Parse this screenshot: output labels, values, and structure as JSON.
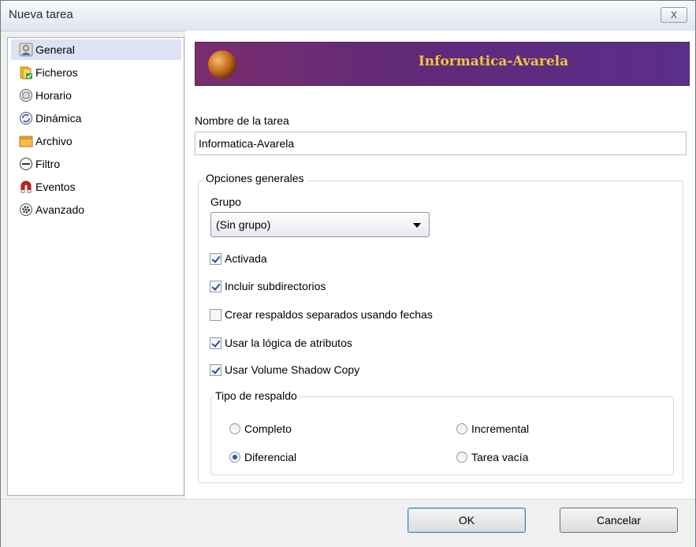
{
  "window": {
    "title": "Nueva tarea",
    "close_label": "X"
  },
  "sidebar": {
    "items": [
      {
        "label": "General",
        "icon": "user-icon",
        "selected": true
      },
      {
        "label": "Ficheros",
        "icon": "files-icon"
      },
      {
        "label": "Horario",
        "icon": "clock-icon"
      },
      {
        "label": "Dinámica",
        "icon": "dynamic-icon"
      },
      {
        "label": "Archivo",
        "icon": "folder-icon"
      },
      {
        "label": "Filtro",
        "icon": "filter-icon"
      },
      {
        "label": "Eventos",
        "icon": "magnet-icon"
      },
      {
        "label": "Avanzado",
        "icon": "gear-icon"
      }
    ]
  },
  "banner": {
    "title": "Informatica-Avarela"
  },
  "task_name": {
    "label": "Nombre de la tarea",
    "value": "Informatica-Avarela"
  },
  "general_options": {
    "legend": "Opciones generales",
    "group_label": "Grupo",
    "group_value": "(Sin grupo)",
    "checkboxes": [
      {
        "label": "Activada",
        "checked": true
      },
      {
        "label": "Incluir subdirectorios",
        "checked": true
      },
      {
        "label": "Crear respaldos separados usando fechas",
        "checked": false
      },
      {
        "label": "Usar la lógica de atributos",
        "checked": true
      },
      {
        "label": "Usar Volume Shadow Copy",
        "checked": true
      }
    ]
  },
  "backup_type": {
    "legend": "Tipo de respaldo",
    "options": [
      {
        "label": "Completo",
        "checked": false
      },
      {
        "label": "Incremental",
        "checked": false
      },
      {
        "label": "Diferencial",
        "checked": true
      },
      {
        "label": "Tarea vacía",
        "checked": false
      }
    ]
  },
  "buttons": {
    "ok": "OK",
    "cancel": "Cancelar"
  },
  "colors": {
    "banner_start": "#7b2d6e",
    "banner_end": "#5a2f8a",
    "banner_text": "#f2c63a",
    "selection": "#dde2f5"
  }
}
